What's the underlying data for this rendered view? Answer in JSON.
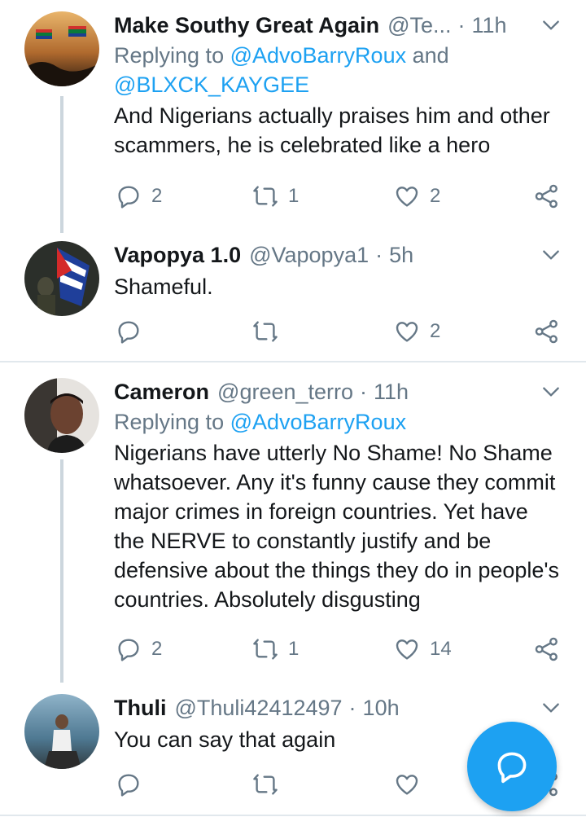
{
  "colors": {
    "accent": "#1da1f2",
    "secondary": "#657786",
    "text": "#14171a",
    "divider": "#e1e8ed"
  },
  "tweets": [
    {
      "name": "Make Southy Great Again",
      "handle": "@Te...",
      "time": "11h",
      "replying_prefix": "Replying to ",
      "replying_to_1": "@AdvoBarryRoux",
      "replying_and": " and",
      "replying_to_2": "@BLXCK_KAYGEE",
      "text": "And Nigerians actually praises him and other scammers, he is celebrated like a hero",
      "replies": "2",
      "retweets": "1",
      "likes": "2"
    },
    {
      "name": "Vapopya 1.0",
      "handle": "@Vapopya1",
      "time": "5h",
      "text": "Shameful.",
      "replies": "",
      "retweets": "",
      "likes": "2"
    },
    {
      "name": "Cameron",
      "handle": "@green_terro",
      "time": "11h",
      "replying_prefix": "Replying to ",
      "replying_to_1": "@AdvoBarryRoux",
      "text": "Nigerians have utterly No Shame! No Shame whatsoever. Any it's funny cause they commit major crimes in foreign countries. Yet have the NERVE to constantly justify and be defensive about the things they do in people's countries. Absolutely disgusting",
      "replies": "2",
      "retweets": "1",
      "likes": "14"
    },
    {
      "name": "Thuli",
      "handle": "@Thuli42412497",
      "time": "10h",
      "text": "You can say that again",
      "replies": "",
      "retweets": "",
      "likes": ""
    }
  ],
  "icons": {
    "reply": "reply-icon",
    "retweet": "retweet-icon",
    "like": "heart-icon",
    "share": "share-icon",
    "more": "chevron-down-icon",
    "compose": "compose-reply-icon"
  }
}
